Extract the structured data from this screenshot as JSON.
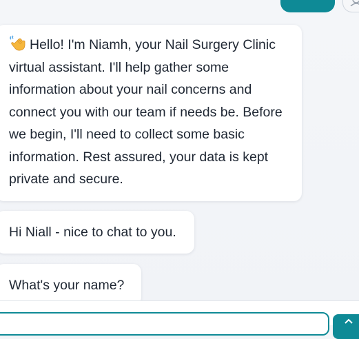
{
  "colors": {
    "accent": "#0e8a96",
    "bubble_bg": "#ffffff",
    "chat_bg": "#f3f5f8"
  },
  "header": {
    "action_button_label": "",
    "avatar_icon": "user-icon"
  },
  "messages": [
    {
      "icon": "waving-hand-icon",
      "text": "Hello! I'm Niamh, your Nail Surgery Clinic virtual assistant. I'll help gather some information about your nail concerns and connect you with our team if needs be. Before we begin, I'll need to collect some basic information. Rest assured, your data is kept private and secure."
    },
    {
      "text": "Hi Niall - nice to chat to you."
    },
    {
      "text": "What's your name?"
    }
  ],
  "composer": {
    "value": "",
    "send_icon": "send-arrow-icon"
  }
}
